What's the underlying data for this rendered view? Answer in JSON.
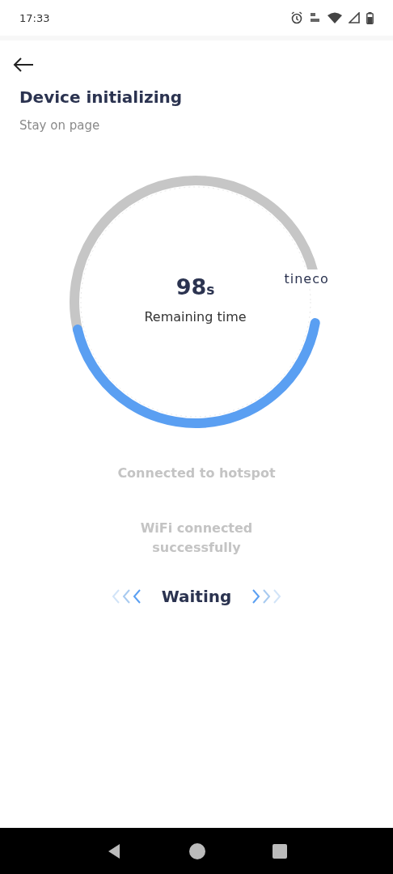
{
  "status_bar": {
    "time": "17:33"
  },
  "header": {
    "title": "Device initializing",
    "subtitle": "Stay on page"
  },
  "timer": {
    "value": "98",
    "unit": "s",
    "caption": "Remaining time",
    "brand": "tineco"
  },
  "steps": [
    {
      "label": "Connected to hotspot",
      "done": false
    },
    {
      "label": "WiFi connected successfully",
      "done": false
    }
  ],
  "status": {
    "label": "Waiting"
  }
}
